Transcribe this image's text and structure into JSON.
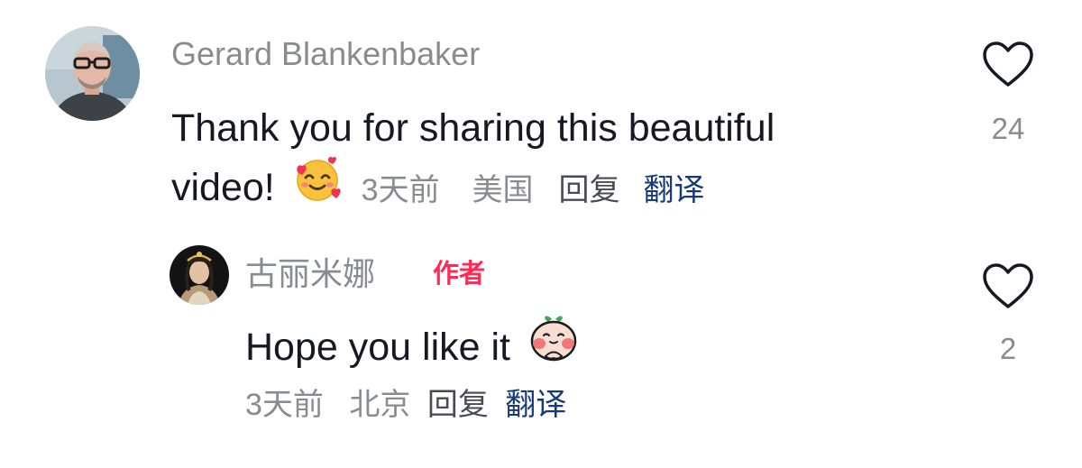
{
  "comments": [
    {
      "username": "Gerard Blankenbaker",
      "text_line1": "Thank you for sharing this beautiful",
      "text_line2": "video!",
      "emoji": "smiling-face-with-hearts",
      "time": "3天前",
      "location": "美国",
      "reply_label": "回复",
      "translate_label": "翻译",
      "like_count": "24"
    }
  ],
  "replies": [
    {
      "username": "古丽米娜",
      "author_badge": "作者",
      "text": "Hope you like it",
      "emoji": "cute-character-sticker",
      "time": "3天前",
      "location": "北京",
      "reply_label": "回复",
      "translate_label": "翻译",
      "like_count": "2"
    }
  ],
  "colors": {
    "text": "#161823",
    "secondary": "#8a8b91",
    "translate": "#163a78",
    "author_badge": "#fe2c55"
  }
}
